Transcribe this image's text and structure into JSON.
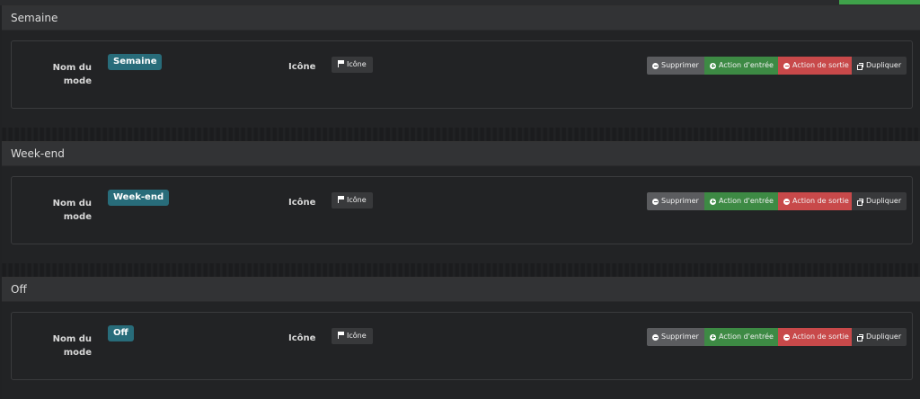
{
  "modes": [
    {
      "heading": "Semaine",
      "name_label": "Nom du mode",
      "mode_name": "Semaine",
      "icon_label": "Icône",
      "icon_button": "Icône",
      "buttons": {
        "delete": "Supprimer",
        "entry": "Action d'entrée",
        "exit": "Action de sortie",
        "duplicate": "Dupliquer"
      }
    },
    {
      "heading": "Week-end",
      "name_label": "Nom du mode",
      "mode_name": "Week-end",
      "icon_label": "Icône",
      "icon_button": "Icône",
      "buttons": {
        "delete": "Supprimer",
        "entry": "Action d'entrée",
        "exit": "Action de sortie",
        "duplicate": "Dupliquer"
      }
    },
    {
      "heading": "Off",
      "name_label": "Nom du mode",
      "mode_name": "Off",
      "icon_label": "Icône",
      "icon_button": "Icône",
      "buttons": {
        "delete": "Supprimer",
        "entry": "Action d'entrée",
        "exit": "Action de sortie",
        "duplicate": "Dupliquer"
      }
    }
  ],
  "colors": {
    "badge": "#286c7a",
    "entry": "#3d8a44",
    "exit": "#c8494a",
    "delete": "#5b5c5f"
  },
  "icons": {
    "delete": "minus-circle-icon",
    "entry": "plus-circle-icon",
    "exit": "minus-circle-icon",
    "duplicate": "copy-icon",
    "icon_button": "flag-icon"
  }
}
